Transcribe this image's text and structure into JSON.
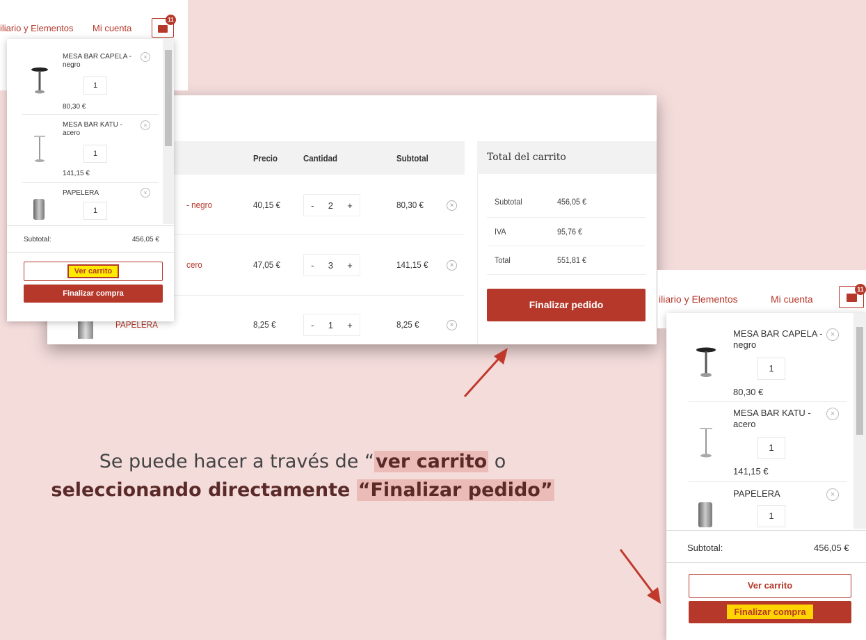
{
  "cart_page": {
    "headers": {
      "price": "Precio",
      "quantity": "Cantidad",
      "subtotal": "Subtotal"
    },
    "rows": [
      {
        "product": "- negro",
        "price": "40,15 €",
        "qty": "2",
        "subtotal": "80,30 €"
      },
      {
        "product": "cero",
        "price": "47,05 €",
        "qty": "3",
        "subtotal": "141,15 €"
      },
      {
        "product": "PAPELERA",
        "price": "8,25 €",
        "qty": "1",
        "subtotal": "8,25 €"
      }
    ],
    "qty_minus": "-",
    "qty_plus": "+",
    "remove_symbol": "×",
    "totals": {
      "title": "Total del carrito",
      "subtotal_label": "Subtotal",
      "subtotal_value": "456,05 €",
      "iva_label": "IVA",
      "iva_value": "95,76 €",
      "total_label": "Total",
      "total_value": "551,81 €",
      "checkout_button": "Finalizar pedido"
    }
  },
  "mini_cart_left": {
    "nav_link_1": "iliario y Elementos",
    "nav_link_2": "Mi cuenta",
    "badge_count": "11",
    "items": [
      {
        "name": "MESA BAR CAPELA - negro",
        "qty": "1",
        "price": "80,30 €"
      },
      {
        "name": "MESA BAR KATU - acero",
        "qty": "1",
        "price": "141,15 €"
      },
      {
        "name": "PAPELERA",
        "qty": "1"
      }
    ],
    "subtotal_label": "Subtotal:",
    "subtotal_value": "456,05 €",
    "view_cart_button": "Ver carrito",
    "checkout_button": "Finalizar compra"
  },
  "mini_cart_right": {
    "nav_link_1": "iliario y Elementos",
    "nav_link_2": "Mi cuenta",
    "badge_count": "11",
    "items": [
      {
        "name": "MESA BAR CAPELA - negro",
        "qty": "1",
        "price": "80,30 €"
      },
      {
        "name": "MESA BAR KATU - acero",
        "qty": "1",
        "price": "141,15 €"
      },
      {
        "name": "PAPELERA",
        "qty": "1"
      }
    ],
    "subtotal_label": "Subtotal:",
    "subtotal_value": "456,05 €",
    "view_cart_button": "Ver carrito",
    "checkout_button": "Finalizar compra"
  },
  "caption": {
    "line1_prefix": "Se puede hacer a través de “",
    "line1_highlight": "ver carrito",
    "line1_suffix": " o",
    "line2_bold": "seleccionando directamente ",
    "line2_highlight": "“Finalizar pedido”"
  },
  "colors": {
    "background": "#f4dcdb",
    "brand": "#b5382a",
    "highlight_yellow": "#ffeb00",
    "highlight_pink": "#ebbcb7",
    "arrow": "#c0392b"
  }
}
